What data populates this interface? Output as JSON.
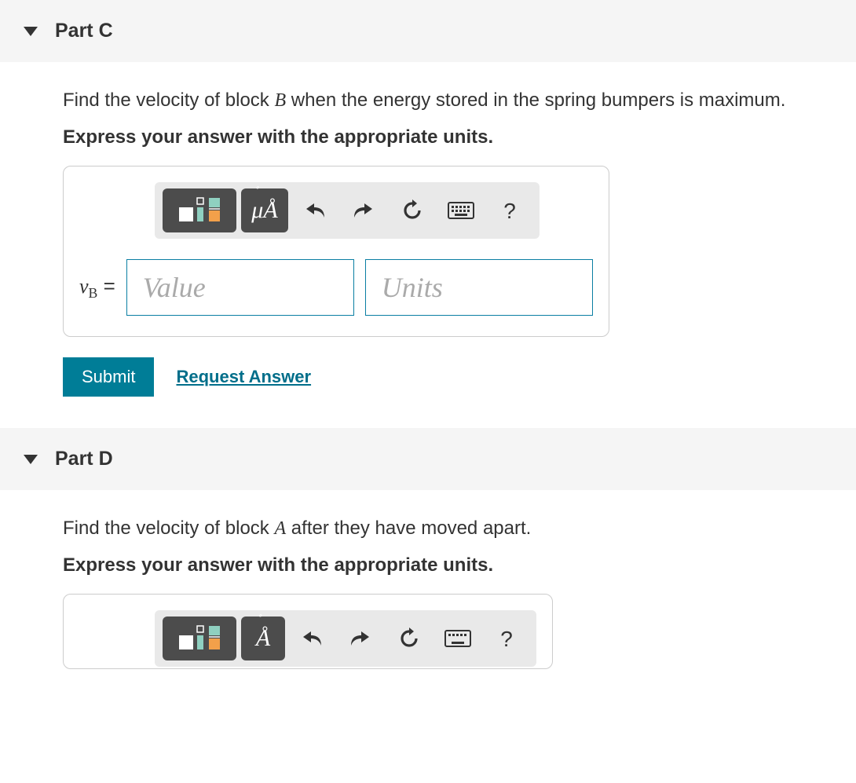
{
  "partC": {
    "title": "Part C",
    "prompt_pre": "Find the velocity of block ",
    "prompt_var": "B",
    "prompt_post": " when the energy stored in the spring bumpers is maximum.",
    "express": "Express your answer with the appropriate units.",
    "var_symbol": "v",
    "var_sub": "B",
    "equals": " =",
    "value_placeholder": "Value",
    "units_placeholder": "Units",
    "submit": "Submit",
    "request": "Request Answer",
    "toolbar": {
      "muA": "μÅ",
      "help": "?"
    }
  },
  "partD": {
    "title": "Part D",
    "prompt_pre": "Find the velocity of block ",
    "prompt_var": "A",
    "prompt_post": " after they have moved apart.",
    "express": "Express your answer with the appropriate units.",
    "toolbar": {
      "help": "?"
    }
  }
}
